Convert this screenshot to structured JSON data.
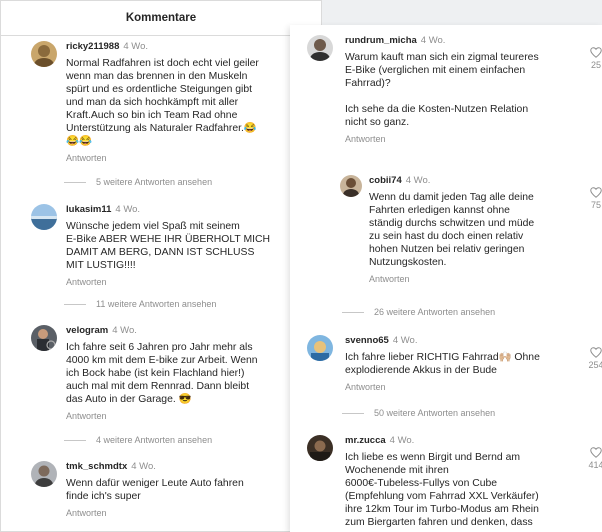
{
  "left_panel": {
    "title": "Kommentare",
    "comments": [
      {
        "user": "ricky211988",
        "time": "4 Wo.",
        "text": "Normal Radfahren ist doch echt viel geiler\nwenn man das brennen in den Muskeln\nspürt und es ordentliche Steigungen gibt\nund man da sich hochkämpft mit aller\nKraft.Auch so bin ich Team Rad ohne\nUnterstützung als Naturaler Radfahrer.😂\n😂😂",
        "reply": "Antworten",
        "more": "5 weitere Antworten ansehen"
      },
      {
        "user": "lukasim11",
        "time": "4 Wo.",
        "text": "Wünsche jedem viel Spaß mit seinem\nE-Bike ABER WEHE IHR ÜBERHOLT MICH\nDAMIT AM BERG, DANN IST SCHLUSS\nMIT LUSTIG!!!!",
        "reply": "Antworten",
        "more": "11 weitere Antworten ansehen"
      },
      {
        "user": "velogram",
        "time": "4 Wo.",
        "text": "Ich fahre seit 6 Jahren pro Jahr mehr als\n4000 km mit dem E-bike zur Arbeit. Wenn\nich Bock habe (ist kein Flachland hier!)\nauch mal mit dem Rennrad. Dann bleibt\ndas Auto in der Garage. 😎",
        "reply": "Antworten",
        "more": "4 weitere Antworten ansehen"
      },
      {
        "user": "tmk_schmdtx",
        "time": "4 Wo.",
        "text": "Wenn dafür weniger Leute Auto fahren\nfinde ich's super",
        "reply": "Antworten"
      }
    ]
  },
  "right_panel": {
    "comments": [
      {
        "user": "rundrum_micha",
        "time": "4 Wo.",
        "text": "Warum kauft man sich ein zigmal teureres\nE-Bike (verglichen mit einem einfachen\nFahrrad)?\n\nIch sehe da die Kosten-Nutzen Relation\nnicht so ganz.",
        "reply": "Antworten",
        "likes": "25"
      },
      {
        "user": "cobii74",
        "time": "4 Wo.",
        "text": "Wenn du damit jeden Tag alle deine\nFahrten erledigen kannst ohne\nständig durchs schwitzen und müde\nzu sein hast du doch einen relativ\nhohen Nutzen bei relativ geringen\nNutzungskosten.",
        "reply": "Antworten",
        "likes": "75",
        "more": "26 weitere Antworten ansehen"
      },
      {
        "user": "svenno65",
        "time": "4 Wo.",
        "text": "Ich fahre lieber RICHTIG Fahrrad🙌🏼 Ohne\nexplodierende Akkus in der Bude",
        "reply": "Antworten",
        "likes": "254",
        "more": "50 weitere Antworten ansehen"
      },
      {
        "user": "mr.zucca",
        "time": "4 Wo.",
        "text": "Ich liebe es wenn Birgit und Bernd am\nWochenende mit ihren\n6000€-Tubeless-Fullys von Cube\n(Empfehlung vom Fahrrad XXL Verkäufer)\nihre 12km Tour im Turbo-Modus am Rhein\nzum Biergarten fahren und denken, dass",
        "likes": "414"
      }
    ]
  }
}
